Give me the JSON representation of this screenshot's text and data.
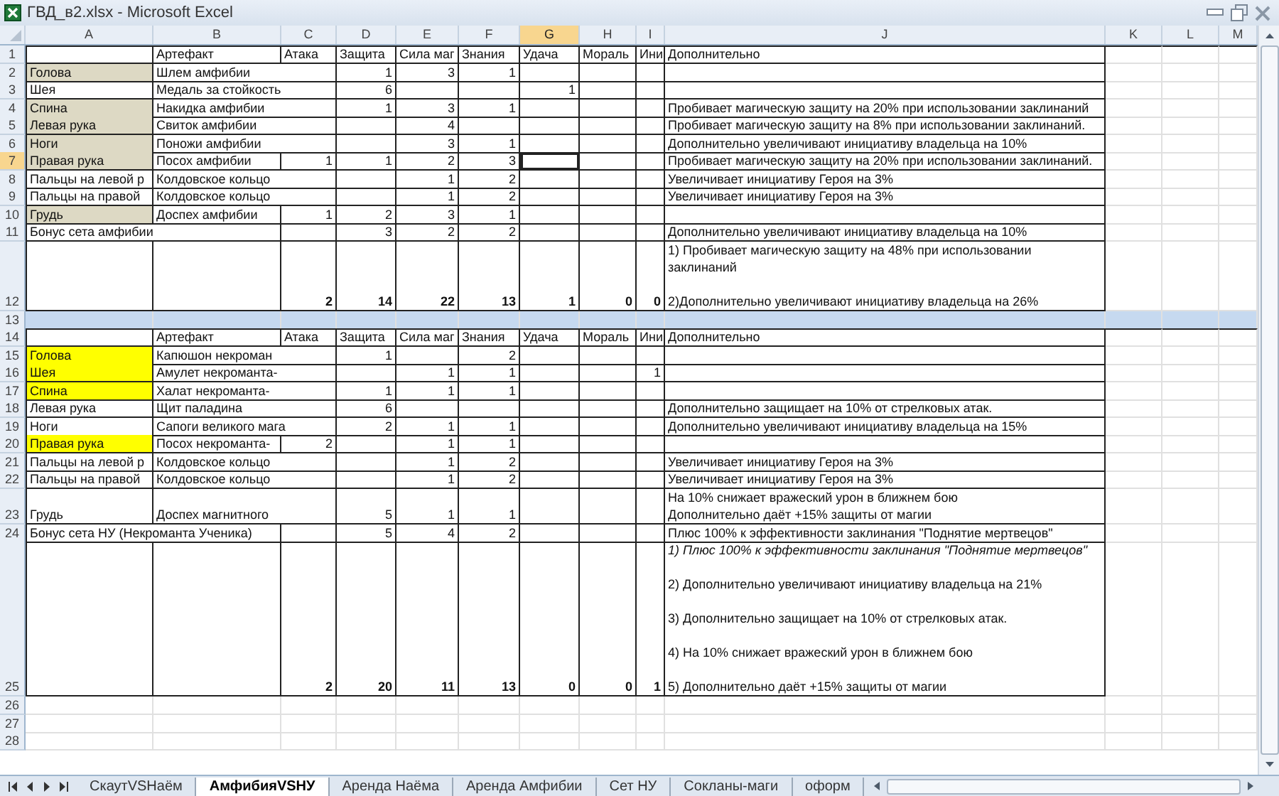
{
  "window": {
    "title": "ГВД_в2.xlsx - Microsoft Excel"
  },
  "columns": [
    {
      "label": "A",
      "selected": false
    },
    {
      "label": "B",
      "selected": false
    },
    {
      "label": "C",
      "selected": false
    },
    {
      "label": "D",
      "selected": false
    },
    {
      "label": "E",
      "selected": false
    },
    {
      "label": "F",
      "selected": false
    },
    {
      "label": "G",
      "selected": true
    },
    {
      "label": "H",
      "selected": false
    },
    {
      "label": "I",
      "selected": false
    },
    {
      "label": "J",
      "selected": false
    },
    {
      "label": "K",
      "selected": false
    },
    {
      "label": "L",
      "selected": false
    },
    {
      "label": "M",
      "selected": false
    }
  ],
  "rows": [
    {
      "num": "1",
      "kind": "header",
      "selected": false,
      "cells": {
        "B": {
          "text": "Артефакт"
        },
        "C": {
          "text": "Атака"
        },
        "D": {
          "text": "Защита"
        },
        "E": {
          "text": "Сила маг"
        },
        "F": {
          "text": "Знания"
        },
        "G": {
          "text": "Удача"
        },
        "H": {
          "text": "Мораль"
        },
        "I": {
          "text": "Ини"
        },
        "J": {
          "text": "Дополнительно"
        }
      }
    },
    {
      "num": "2",
      "kind": "item",
      "selected": false,
      "cells": {
        "A": {
          "text": "Голова",
          "color": "#ddd9c4"
        },
        "B": {
          "text": "Шлем амфибии"
        },
        "D": {
          "text": "1"
        },
        "E": {
          "text": "3"
        },
        "F": {
          "text": "1"
        }
      }
    },
    {
      "num": "3",
      "kind": "item",
      "selected": false,
      "cells": {
        "A": {
          "text": "Шея"
        },
        "B": {
          "text": "Медаль за стойкость"
        },
        "D": {
          "text": "6"
        },
        "G": {
          "text": "1"
        }
      }
    },
    {
      "num": "4",
      "kind": "item",
      "selected": false,
      "cells": {
        "A": {
          "text": "Спина",
          "color": "#ddd9c4"
        },
        "B": {
          "text": "Накидка амфибии"
        },
        "D": {
          "text": "1"
        },
        "E": {
          "text": "3"
        },
        "F": {
          "text": "1"
        },
        "J": {
          "text": "Пробивает магическую защиту на 20% при использовании заклинаний"
        }
      }
    },
    {
      "num": "5",
      "kind": "item",
      "selected": false,
      "cells": {
        "A": {
          "text": "Левая рука",
          "color": "#ddd9c4"
        },
        "B": {
          "text": "Свиток амфибии"
        },
        "E": {
          "text": "4"
        },
        "J": {
          "text": "Пробивает магическую защиту на 8% при использовании заклинаний."
        }
      }
    },
    {
      "num": "6",
      "kind": "item",
      "selected": false,
      "cells": {
        "A": {
          "text": "Ноги",
          "color": "#ddd9c4"
        },
        "B": {
          "text": "Поножи амфибии"
        },
        "E": {
          "text": "3"
        },
        "F": {
          "text": "1"
        },
        "J": {
          "text": "Дополнительно увеличивают инициативу владельца на 10%"
        }
      }
    },
    {
      "num": "7",
      "kind": "item",
      "selected": true,
      "cells": {
        "A": {
          "text": "Правая рука",
          "color": "#ddd9c4"
        },
        "B": {
          "text": "Посох амфибии"
        },
        "C": {
          "text": "1"
        },
        "D": {
          "text": "1"
        },
        "E": {
          "text": "2"
        },
        "F": {
          "text": "3"
        },
        "J": {
          "text": "Пробивает магическую защиту на 20% при использовании заклинаний."
        }
      }
    },
    {
      "num": "8",
      "kind": "item",
      "selected": false,
      "cells": {
        "A": {
          "text": "Пальцы на левой р"
        },
        "B": {
          "text": "Колдовское кольцо"
        },
        "E": {
          "text": "1"
        },
        "F": {
          "text": "2"
        },
        "J": {
          "text": "Увеличивает инициативу Героя на 3%"
        }
      }
    },
    {
      "num": "9",
      "kind": "item",
      "selected": false,
      "cells": {
        "A": {
          "text": "Пальцы на правой"
        },
        "B": {
          "text": "Колдовское кольцо"
        },
        "E": {
          "text": "1"
        },
        "F": {
          "text": "2"
        },
        "J": {
          "text": "Увеличивает инициативу Героя на 3%"
        }
      }
    },
    {
      "num": "10",
      "kind": "item",
      "selected": false,
      "cells": {
        "A": {
          "text": "Грудь",
          "color": "#ddd9c4"
        },
        "B": {
          "text": "Доспех амфибии"
        },
        "C": {
          "text": "1"
        },
        "D": {
          "text": "2"
        },
        "E": {
          "text": "3"
        },
        "F": {
          "text": "1"
        }
      }
    },
    {
      "num": "11",
      "kind": "item",
      "selected": false,
      "cells": {
        "A": {
          "text": "Бонус сета амфибии"
        },
        "D": {
          "text": "3"
        },
        "E": {
          "text": "2"
        },
        "F": {
          "text": "2"
        },
        "J": {
          "text": "Дополнительно увеличивают инициативу владельца на 10%"
        }
      }
    },
    {
      "num": "12",
      "kind": "total",
      "selected": false,
      "cells": {
        "C": {
          "text": "2"
        },
        "D": {
          "text": "14"
        },
        "E": {
          "text": "22"
        },
        "F": {
          "text": "13"
        },
        "G": {
          "text": "1"
        },
        "H": {
          "text": "0"
        },
        "I": {
          "text": "0"
        },
        "J": {
          "kind": "notes",
          "lines": [
            {
              "text": "1) Пробивает магическую защиту на 48% при использовании заклинаний",
              "italic": false
            },
            {
              "text": "2)Дополнительно увеличивают инициативу владельца на 26%",
              "italic": false
            }
          ]
        }
      }
    },
    {
      "num": "13",
      "kind": "band",
      "selected": false,
      "cells": {}
    },
    {
      "num": "14",
      "kind": "header",
      "selected": false,
      "cells": {
        "B": {
          "text": "Артефакт"
        },
        "C": {
          "text": "Атака"
        },
        "D": {
          "text": "Защита"
        },
        "E": {
          "text": "Сила маг"
        },
        "F": {
          "text": "Знания"
        },
        "G": {
          "text": "Удача"
        },
        "H": {
          "text": "Мораль"
        },
        "I": {
          "text": "Ини"
        },
        "J": {
          "text": "Дополнительно"
        }
      }
    },
    {
      "num": "15",
      "kind": "item",
      "selected": false,
      "cells": {
        "A": {
          "text": "Голова",
          "color": "#ffff00"
        },
        "B": {
          "text": "Капюшон некроман"
        },
        "D": {
          "text": "1"
        },
        "F": {
          "text": "2"
        }
      }
    },
    {
      "num": "16",
      "kind": "item",
      "selected": false,
      "cells": {
        "A": {
          "text": "Шея",
          "color": "#ffff00"
        },
        "B": {
          "text": "Амулет некроманта-"
        },
        "E": {
          "text": "1"
        },
        "F": {
          "text": "1"
        },
        "I": {
          "text": "1"
        }
      }
    },
    {
      "num": "17",
      "kind": "item",
      "selected": false,
      "cells": {
        "A": {
          "text": "Спина",
          "color": "#ffff00"
        },
        "B": {
          "text": "Халат некроманта-"
        },
        "D": {
          "text": "1"
        },
        "E": {
          "text": "1"
        },
        "F": {
          "text": "1"
        }
      }
    },
    {
      "num": "18",
      "kind": "item",
      "selected": false,
      "cells": {
        "A": {
          "text": "Левая рука"
        },
        "B": {
          "text": "Щит паладина"
        },
        "D": {
          "text": "6"
        },
        "J": {
          "text": "Дополнительно защищает на 10% от стрелковых атак."
        }
      }
    },
    {
      "num": "19",
      "kind": "item",
      "selected": false,
      "cells": {
        "A": {
          "text": "Ноги"
        },
        "B": {
          "text": "Сапоги великого мага"
        },
        "D": {
          "text": "2"
        },
        "E": {
          "text": "1"
        },
        "F": {
          "text": "1"
        },
        "J": {
          "text": "Дополнительно увеличивают инициативу владельца на 15%"
        }
      }
    },
    {
      "num": "20",
      "kind": "item",
      "selected": false,
      "cells": {
        "A": {
          "text": "Правая рука",
          "color": "#ffff00"
        },
        "B": {
          "text": "Посох некроманта-"
        },
        "C": {
          "text": "2"
        },
        "E": {
          "text": "1"
        },
        "F": {
          "text": "1"
        }
      }
    },
    {
      "num": "21",
      "kind": "item",
      "selected": false,
      "cells": {
        "A": {
          "text": "Пальцы на левой р"
        },
        "B": {
          "text": "Колдовское кольцо"
        },
        "E": {
          "text": "1"
        },
        "F": {
          "text": "2"
        },
        "J": {
          "text": "Увеличивает инициативу Героя на 3%"
        }
      }
    },
    {
      "num": "22",
      "kind": "item",
      "selected": false,
      "cells": {
        "A": {
          "text": "Пальцы на правой"
        },
        "B": {
          "text": "Колдовское кольцо"
        },
        "E": {
          "text": "1"
        },
        "F": {
          "text": "2"
        },
        "J": {
          "text": "Увеличивает инициативу Героя на 3%"
        }
      }
    },
    {
      "num": "23",
      "kind": "item",
      "selected": false,
      "cells": {
        "A": {
          "text": "Грудь"
        },
        "B": {
          "text": "Доспех магнитного"
        },
        "D": {
          "text": "5"
        },
        "E": {
          "text": "1"
        },
        "F": {
          "text": "1"
        },
        "J": {
          "kind": "lines",
          "lines": [
            {
              "text": "На 10% снижает вражеский урон в ближнем бою",
              "italic": false
            },
            {
              "text": "Дополнительно даёт +15% защиты от магии",
              "italic": false
            }
          ]
        }
      }
    },
    {
      "num": "24",
      "kind": "item",
      "selected": false,
      "cells": {
        "A": {
          "text": "Бонус сета НУ (Некроманта Ученика)"
        },
        "D": {
          "text": "5"
        },
        "E": {
          "text": "4"
        },
        "F": {
          "text": "2"
        },
        "J": {
          "text": "Плюс 100% к эффективности заклинания \"Поднятие мертвецов\""
        }
      }
    },
    {
      "num": "25",
      "kind": "total",
      "selected": false,
      "cells": {
        "C": {
          "text": "2"
        },
        "D": {
          "text": "20"
        },
        "E": {
          "text": "11"
        },
        "F": {
          "text": "13"
        },
        "G": {
          "text": "0"
        },
        "H": {
          "text": "0"
        },
        "I": {
          "text": "1"
        },
        "J": {
          "kind": "notes",
          "lines": [
            {
              "text": "1) Плюс 100% к эффективности заклинания \"Поднятие мертвецов\"",
              "italic": true
            },
            {
              "text": "2) Дополнительно увеличивают инициативу владельца на 21%",
              "italic": false
            },
            {
              "text": "3) Дополнительно защищает на 10% от стрелковых атак.",
              "italic": false
            },
            {
              "text": "4) На 10% снижает вражеский урон в ближнем бою",
              "italic": false
            },
            {
              "text": "5) Дополнительно даёт +15% защиты от магии",
              "italic": false
            }
          ]
        }
      }
    },
    {
      "num": "26",
      "kind": "blank",
      "selected": false,
      "cells": {}
    },
    {
      "num": "27",
      "kind": "blank",
      "selected": false,
      "cells": {}
    },
    {
      "num": "28",
      "kind": "blank",
      "selected": false,
      "cells": {}
    }
  ],
  "sheet_tabs": [
    {
      "label": "СкаутVSНаём",
      "selected": false
    },
    {
      "label": "АмфибияVSНУ",
      "selected": true
    },
    {
      "label": "Аренда Наёма",
      "selected": false
    },
    {
      "label": "Аренда Амфибии",
      "selected": false
    },
    {
      "label": "Сет НУ",
      "selected": false
    },
    {
      "label": "Сокланы-маги",
      "selected": false
    },
    {
      "label": "оформ",
      "selected": false
    }
  ]
}
